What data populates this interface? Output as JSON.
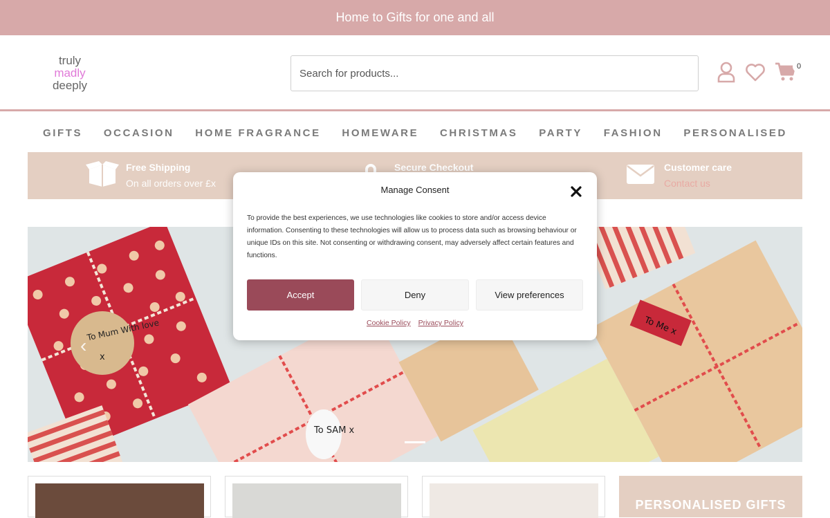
{
  "announcement": "Home to Gifts for one and all",
  "logo": {
    "line1": "truly",
    "line2": "madly",
    "line3": "deeply"
  },
  "search": {
    "placeholder": "Search for products..."
  },
  "header_icons": {
    "account": "user-icon",
    "wishlist": "heart-icon",
    "cart": "cart-icon",
    "cart_count": "0"
  },
  "nav": [
    "GIFTS",
    "OCCASION",
    "HOME FRAGRANCE",
    "HOMEWARE",
    "CHRISTMAS",
    "PARTY",
    "FASHION",
    "PERSONALISED"
  ],
  "features": [
    {
      "title": "Free Shipping",
      "sub": "On all orders over £x",
      "icon": "box-icon"
    },
    {
      "title": "Secure Checkout",
      "sub": "",
      "icon": "lock-icon"
    },
    {
      "title": "Customer care",
      "sub": "Contact us",
      "icon": "envelope-icon"
    }
  ],
  "hero": {
    "tags": {
      "mum": "To Mum With love",
      "mum_x": "x",
      "sam": "To SAM x",
      "me": "To Me x"
    }
  },
  "promo": {
    "label": "PERSONALISED GIFTS"
  },
  "consent": {
    "title": "Manage Consent",
    "body": "To provide the best experiences, we use technologies like cookies to store and/or access device information. Consenting to these technologies will allow us to process data such as browsing behaviour or unique IDs on this site. Not consenting or withdrawing consent, may adversely affect certain features and functions.",
    "accept": "Accept",
    "deny": "Deny",
    "preferences": "View preferences",
    "cookie_policy": "Cookie Policy",
    "privacy_policy": "Privacy Policy"
  },
  "colors": {
    "brand_pink": "#d7a9a9",
    "beige": "#e4cfc2",
    "accept": "#9a4a59"
  }
}
